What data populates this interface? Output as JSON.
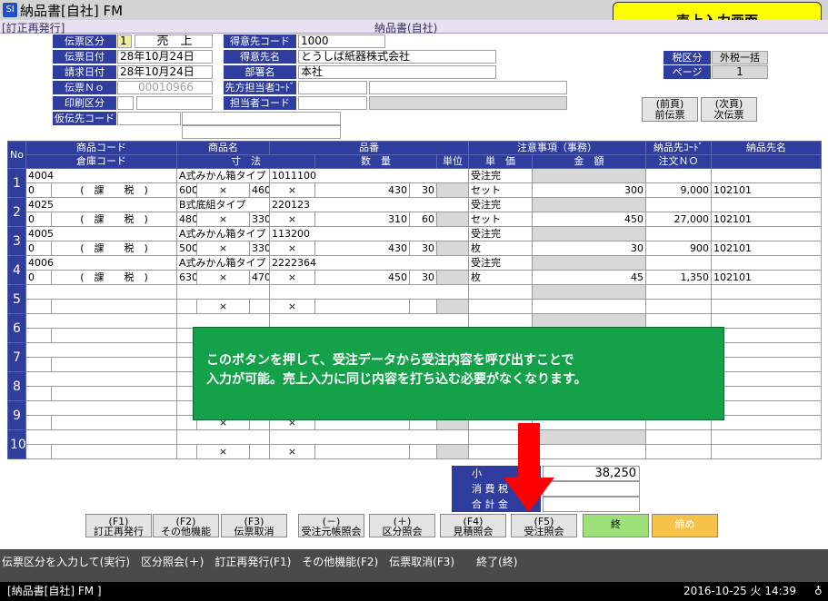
{
  "window": {
    "title": "納品書[自社] FM",
    "logo": "SI"
  },
  "subbar": {
    "left": "[訂正再発行]",
    "center": "納品書(自社)"
  },
  "callout": "売上入力画面",
  "header": {
    "denpyo_kubun_label": "伝票区分",
    "denpyo_kubun_code": "1",
    "denpyo_kubun_value": "売　上",
    "denpyo_date_label": "伝票日付",
    "denpyo_date_value": "28年10月24日",
    "seikyu_date_label": "請求日付",
    "seikyu_date_value": "28年10月24日",
    "denpyo_no_label": "伝票Ｎｏ",
    "denpyo_no_value": "00010966",
    "insatsu_label": "印刷区分",
    "kari_label": "仮伝先コード",
    "tokui_code_label": "得意先コード",
    "tokui_code_value": "1000",
    "tokui_name_label": "得意先名",
    "tokui_name_value": "とうしば紙器株式会社",
    "busho_label": "部署名",
    "busho_value": "本社",
    "senpo_label": "先方担当者ｺｰﾄﾞ",
    "tanto_label": "担当者コード",
    "zei_label": "税区分",
    "zei_value": "外税一括",
    "page_label": "ページ",
    "page_value": "1",
    "prev_btn": "(前頁)\n前伝票",
    "next_btn": "(次頁)\n次伝票"
  },
  "columns": {
    "no": "No",
    "shohin_code": "商品コード",
    "shohin_name": "商品名",
    "hinban": "品番",
    "chui": "注意事項（事務）",
    "nohin_code": "納品先ｺｰﾄﾞ",
    "nohin_name": "納品先名",
    "soko": "倉庫コード",
    "sunpo": "寸　法",
    "suryo": "数　量",
    "tani": "単位",
    "tanka": "単　価",
    "kingaku": "金　額",
    "order": "注文ＮＯ"
  },
  "rows": [
    {
      "no": "1",
      "code": "4004",
      "name": "A式みかん箱タイプ",
      "hinban": "1011100",
      "juchu": "受注完",
      "soko": "0",
      "tax": "(　課　　税　)",
      "d1": "600",
      "d2": "460",
      "qty": "430",
      "unit_qty": "30",
      "unit": "セット",
      "price": "300",
      "amount": "9,000",
      "order": "102101"
    },
    {
      "no": "2",
      "code": "4025",
      "name": "B式底組タイプ",
      "hinban": "220123",
      "juchu": "受注完",
      "soko": "0",
      "tax": "(　課　　税　)",
      "d1": "480",
      "d2": "330",
      "qty": "310",
      "unit_qty": "60",
      "unit": "セット",
      "price": "450",
      "amount": "27,000",
      "order": "102101"
    },
    {
      "no": "3",
      "code": "4005",
      "name": "A式みかん箱タイプ",
      "hinban": "113200",
      "juchu": "受注完",
      "soko": "0",
      "tax": "(　課　　税　)",
      "d1": "500",
      "d2": "330",
      "qty": "430",
      "unit_qty": "30",
      "unit": "枚",
      "price": "30",
      "amount": "900",
      "order": "102101"
    },
    {
      "no": "4",
      "code": "4006",
      "name": "A式みかん箱タイプ",
      "hinban": "2222364",
      "juchu": "受注完",
      "soko": "0",
      "tax": "(　課　　税　)",
      "d1": "630",
      "d2": "470",
      "qty": "450",
      "unit_qty": "30",
      "unit": "枚",
      "price": "45",
      "amount": "1,350",
      "order": "102101"
    },
    {
      "no": "5"
    },
    {
      "no": "6"
    },
    {
      "no": "7"
    },
    {
      "no": "8"
    },
    {
      "no": "9"
    },
    {
      "no": "10"
    }
  ],
  "times": "×",
  "totals": {
    "sub_label": "小",
    "sub_value": "38,250",
    "tax_label": "消 費 税",
    "total_label": "合 計 金"
  },
  "note": "このボタンを押して、受注データから受注内容を呼び出すことで\n入力が可能。売上入力に同じ内容を打ち込む必要がなくなります。",
  "fkeys": [
    {
      "key": "(F1)",
      "label": "訂正再発行"
    },
    {
      "key": "(F2)",
      "label": "その他機能"
    },
    {
      "key": "(F3)",
      "label": "伝票取消"
    },
    {
      "key": "(－)",
      "label": "受注元帳照会"
    },
    {
      "key": "(＋)",
      "label": "区分照会"
    },
    {
      "key": "(F4)",
      "label": "見積照会"
    },
    {
      "key": "(F5)",
      "label": "受注照会"
    },
    {
      "key": "",
      "label": "終"
    },
    {
      "key": "",
      "label": "締め"
    }
  ],
  "status": "伝票区分を入力して(実行)　区分照会(＋)　訂正再発行(F1)　その他機能(F2)　伝票取消(F3)　　終了(終)",
  "taskbar": {
    "app": "[納品書[自社] FM ]",
    "datetime": "2016-10-25 火 14:39"
  }
}
